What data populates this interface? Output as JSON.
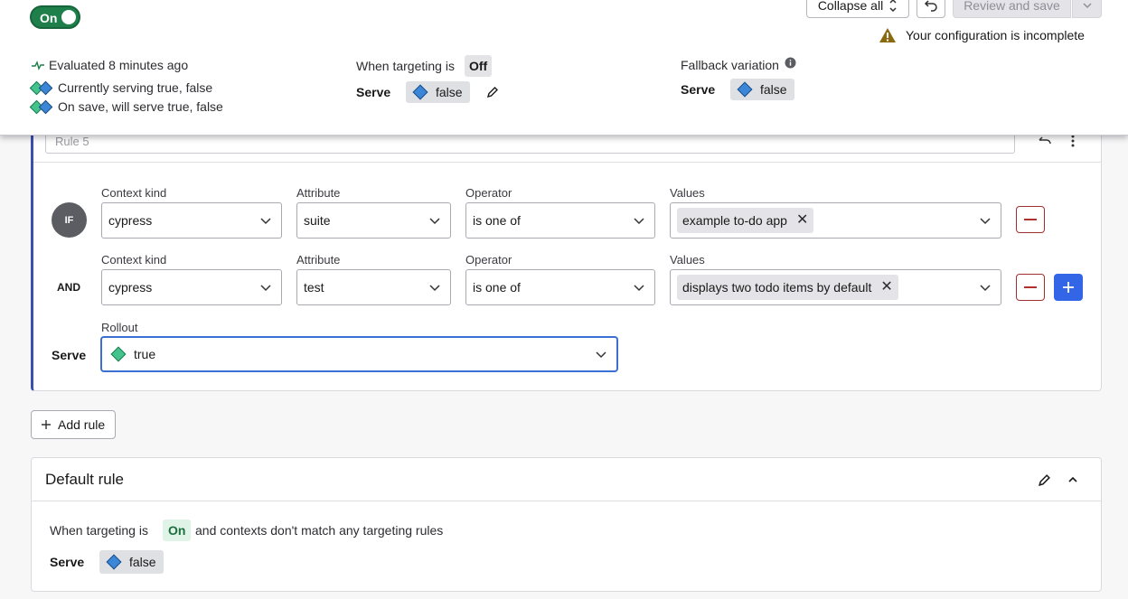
{
  "header": {
    "toggle_label": "On",
    "collapse_label": "Collapse all",
    "review_label": "Review and save",
    "warning_text": "Your configuration is incomplete",
    "evaluated_text": "Evaluated 8 minutes ago",
    "currently_serving": "Currently serving true, false",
    "on_save": "On save, will serve true, false",
    "targeting_label": "When targeting is",
    "targeting_state": "Off",
    "serve_label": "Serve",
    "serve_value": "false",
    "fallback_label": "Fallback variation",
    "fallback_serve_label": "Serve",
    "fallback_value": "false"
  },
  "rule": {
    "name_placeholder": "Rule 5",
    "conditions": [
      {
        "connector": "IF",
        "context_kind_label": "Context kind",
        "context_kind": "cypress",
        "attribute_label": "Attribute",
        "attribute": "suite",
        "operator_label": "Operator",
        "operator": "is one of",
        "values_label": "Values",
        "value": "example to-do app"
      },
      {
        "connector": "AND",
        "context_kind_label": "Context kind",
        "context_kind": "cypress",
        "attribute_label": "Attribute",
        "attribute": "test",
        "operator_label": "Operator",
        "operator": "is one of",
        "values_label": "Values",
        "value": "displays two todo items by default"
      }
    ],
    "rollout_label": "Rollout",
    "serve_label": "Serve",
    "serve_value": "true"
  },
  "add_rule_label": "Add rule",
  "default_rule": {
    "title": "Default rule",
    "text_before": "When targeting is",
    "state": "On",
    "text_after": "and contexts don't match any targeting rules",
    "serve_label": "Serve",
    "serve_value": "false"
  },
  "colors": {
    "toggle_on": "#1f7f4b",
    "primary": "#3366e6",
    "danger": "#a03030",
    "true_variation": "#44c38d",
    "false_variation": "#3b86d6",
    "warning": "#8a6a10"
  }
}
